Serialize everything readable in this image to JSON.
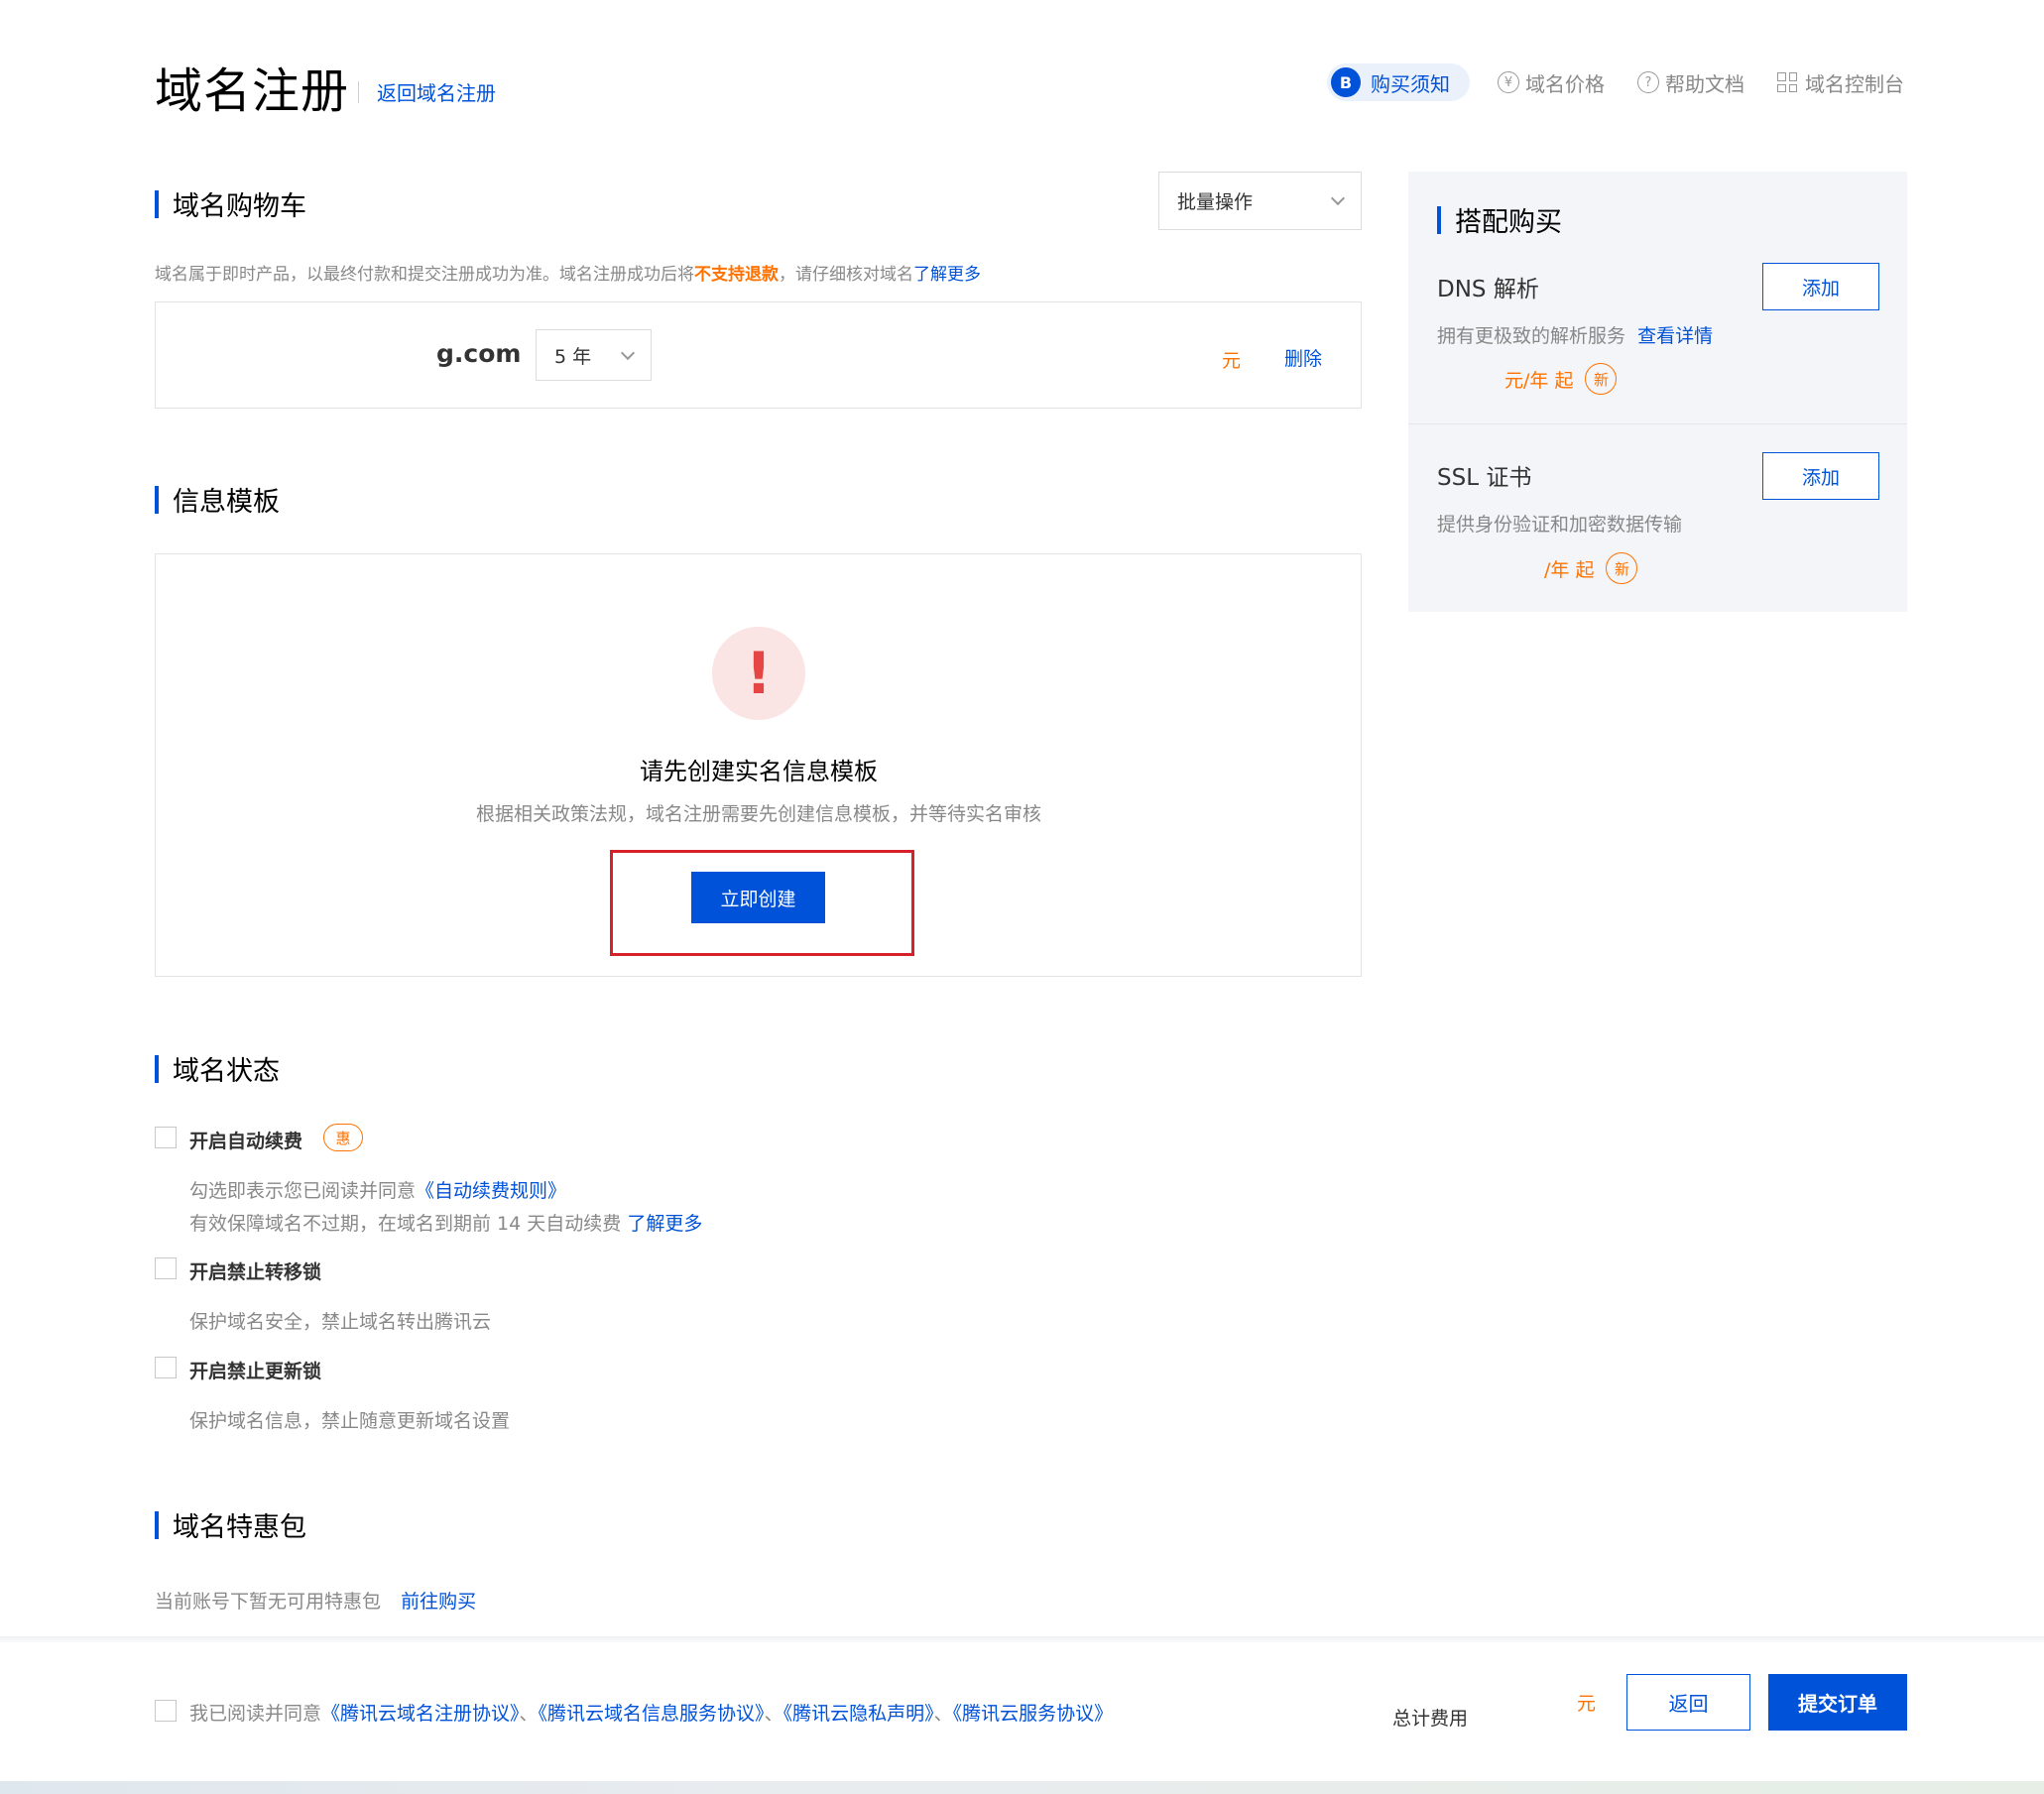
{
  "header": {
    "title": "域名注册",
    "back_link": "返回域名注册",
    "nav": [
      {
        "label": "购买须知",
        "icon": "doc-badge-icon",
        "active": true
      },
      {
        "label": "域名价格",
        "icon": "yen-icon",
        "active": false
      },
      {
        "label": "帮助文档",
        "icon": "help-icon",
        "active": false
      },
      {
        "label": "域名控制台",
        "icon": "grid-icon",
        "active": false
      }
    ],
    "badge_glyph": "B",
    "yen_glyph": "¥",
    "help_glyph": "?"
  },
  "cart": {
    "title": "域名购物车",
    "batch_label": "批量操作",
    "note_prefix": "域名属于即时产品，以最终付款和提交注册成功为准。域名注册成功后将",
    "note_highlight": "不支持退款",
    "note_suffix": "，请仔细核对域名",
    "note_link": "了解更多",
    "item": {
      "domain": "g.com",
      "years": "5 年",
      "price_unit": "元",
      "delete": "删除"
    }
  },
  "template": {
    "title": "信息模板",
    "warn_glyph": "!",
    "prompt": "请先创建实名信息模板",
    "desc": "根据相关政策法规，域名注册需要先创建信息模板，并等待实名审核",
    "create_button": "立即创建"
  },
  "status": {
    "title": "域名状态",
    "options": [
      {
        "label": "开启自动续费",
        "badge": "惠",
        "desc1_prefix": "勾选即表示您已阅读并同意",
        "desc1_link": "《自动续费规则》",
        "desc2_prefix": "有效保障域名不过期，在域名到期前 14 天自动续费",
        "desc2_link": "了解更多"
      },
      {
        "label": "开启禁止转移锁",
        "desc": "保护域名安全，禁止域名转出腾讯云"
      },
      {
        "label": "开启禁止更新锁",
        "desc": "保护域名信息，禁止随意更新域名设置"
      }
    ]
  },
  "pack": {
    "title": "域名特惠包",
    "note": "当前账号下暂无可用特惠包",
    "link": "前往购买"
  },
  "sidebar": {
    "title": "搭配购买",
    "items": [
      {
        "name": "DNS 解析",
        "add": "添加",
        "desc": "拥有更极致的解析服务",
        "link": "查看详情",
        "price": "元/年 起",
        "new": "新"
      },
      {
        "name": "SSL 证书",
        "add": "添加",
        "desc": "提供身份验证和加密数据传输",
        "price": "/年 起",
        "new": "新"
      }
    ]
  },
  "footer": {
    "agree_prefix": "我已阅读并同意",
    "agreements": [
      "《腾讯云域名注册协议》",
      "《腾讯云域名信息服务协议》",
      "《腾讯云隐私声明》",
      "《腾讯云服务协议》"
    ],
    "separator": "、",
    "total_label": "总计费用",
    "total_unit": "元",
    "back": "返回",
    "submit": "提交订单"
  },
  "colors": {
    "primary": "#0052d9",
    "warning": "#ff7200",
    "danger": "#d6212b",
    "panel_bg": "#f3f5f8"
  }
}
